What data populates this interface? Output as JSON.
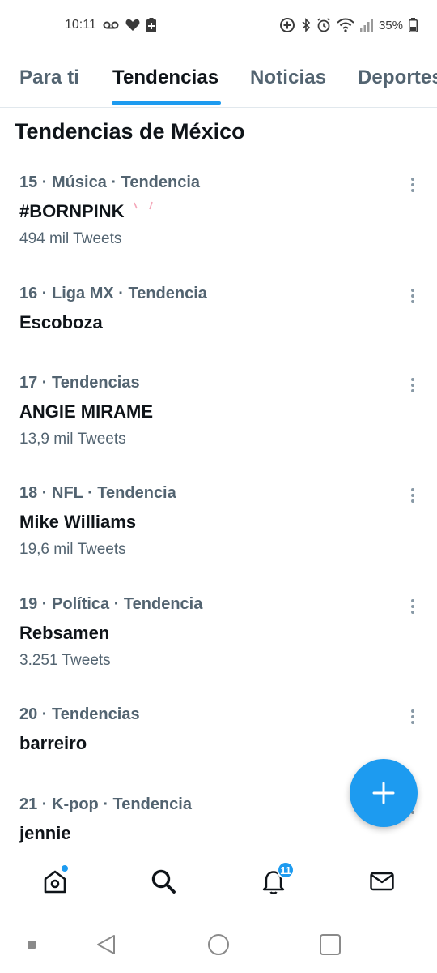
{
  "status_bar": {
    "time": "10:11",
    "battery_percent": "35%",
    "left_icons": [
      "voicemail-icon",
      "heart-icon",
      "battery-plus-icon"
    ],
    "right_icons": [
      "data-saver-icon",
      "bluetooth-icon",
      "alarm-icon",
      "wifi-icon",
      "signal-icon",
      "battery-icon"
    ]
  },
  "tabs": [
    {
      "label": "Para ti",
      "active": false
    },
    {
      "label": "Tendencias",
      "active": true
    },
    {
      "label": "Noticias",
      "active": false
    },
    {
      "label": "Deportes",
      "active": false
    }
  ],
  "section_title": "Tendencias de México",
  "trends": [
    {
      "meta": "15 · Música · Tendencia",
      "name": "#BORNPINK",
      "count": "494 mil Tweets"
    },
    {
      "meta": "16 · Liga MX · Tendencia",
      "name": "Escoboza",
      "count": ""
    },
    {
      "meta": "17 · Tendencias",
      "name": "ANGIE MIRAME",
      "count": "13,9 mil Tweets"
    },
    {
      "meta": "18 · NFL · Tendencia",
      "name": "Mike Williams",
      "count": "19,6 mil Tweets"
    },
    {
      "meta": "19 · Política · Tendencia",
      "name": "Rebsamen",
      "count": "3.251 Tweets"
    },
    {
      "meta": "20 · Tendencias",
      "name": "barreiro",
      "count": ""
    },
    {
      "meta": "21 · K-pop · Tendencia",
      "name": "jennie",
      "count": ""
    }
  ],
  "fab": {
    "icon": "plus-icon"
  },
  "bottom_nav": {
    "items": [
      "home-icon",
      "search-icon",
      "notifications-icon",
      "messages-icon"
    ],
    "notifications_badge": "11"
  },
  "system_nav": [
    "recent-apps-icon",
    "back-icon",
    "home-button-icon",
    "overview-icon"
  ],
  "colors": {
    "accent": "#1d9bf0",
    "text_primary": "#0f1419",
    "text_secondary": "#536471",
    "divider": "#e1e8ed"
  }
}
